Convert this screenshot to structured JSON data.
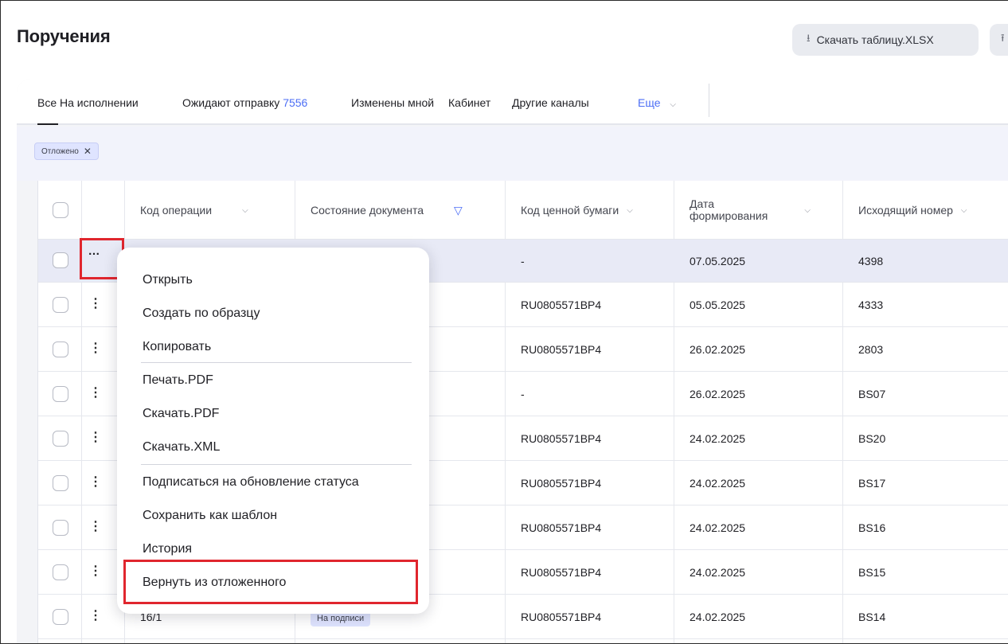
{
  "page": {
    "title": "Поручения"
  },
  "toolbar": {
    "download_label": "Скачать таблицу.XLSX",
    "download_icon": "download-icon",
    "extra_icon": "upload-icon"
  },
  "tabs": [
    {
      "label": "Все",
      "active": true
    },
    {
      "label": "На исполнении"
    },
    {
      "label": "Ожидают отправку",
      "count": "7556"
    },
    {
      "label": "Изменены мной"
    },
    {
      "label": "Кабинет"
    },
    {
      "label": "Другие каналы"
    },
    {
      "label": "Еще",
      "icon": "chevron-down-icon"
    }
  ],
  "filters": {
    "chip_label": "Отложено",
    "chip_close": "✕"
  },
  "table": {
    "columns": [
      {
        "label": "Код операции"
      },
      {
        "label": "Состояние документа"
      },
      {
        "label": "Код ценной бумаги"
      },
      {
        "label": "Дата формирования"
      },
      {
        "label": "Исходящий номер"
      }
    ],
    "header_line1": "Дата",
    "header_line2": "формирования",
    "rows": [
      {
        "code": "",
        "status": "",
        "security": "-",
        "date": "07.05.2025",
        "number": "4398"
      },
      {
        "code": "",
        "status": "",
        "security": "RU0805571BP4",
        "date": "05.05.2025",
        "number": "4333"
      },
      {
        "code": "",
        "status": "",
        "security": "RU0805571BP4",
        "date": "26.02.2025",
        "number": "2803"
      },
      {
        "code": "",
        "status": "",
        "security": "-",
        "date": "26.02.2025",
        "number": "BS07"
      },
      {
        "code": "",
        "status": "",
        "security": "RU0805571BP4",
        "date": "24.02.2025",
        "number": "BS20"
      },
      {
        "code": "",
        "status": "",
        "security": "RU0805571BP4",
        "date": "24.02.2025",
        "number": "BS17"
      },
      {
        "code": "",
        "status": "",
        "security": "RU0805571BP4",
        "date": "24.02.2025",
        "number": "BS16"
      },
      {
        "code": "",
        "status": "",
        "security": "RU0805571BP4",
        "date": "24.02.2025",
        "number": "BS15"
      },
      {
        "code": "16/1",
        "status": "На подписи",
        "security": "RU0805571BP4",
        "date": "24.02.2025",
        "number": "BS14"
      }
    ]
  },
  "context_menu": {
    "items": [
      "Открыть",
      "Создать по образцу",
      "Копировать",
      "Печать.PDF",
      "Скачать.PDF",
      "Скачать.XML",
      "Подписаться на обновление статуса",
      "Сохранить как шаблон",
      "История",
      "Вернуть из отложенного"
    ],
    "highlighted_item": "Вернуть из отложенного",
    "highlight_color": "#e0262e"
  },
  "icons": {
    "row_actions_open": "…",
    "row_actions": "⋮",
    "sort": "⌵",
    "filter": "▽"
  },
  "colors": {
    "accent": "#4c6ef5",
    "annotation": "#e0262e",
    "selected_row": "#e8eaf6",
    "badge": "#dfe4ff"
  }
}
